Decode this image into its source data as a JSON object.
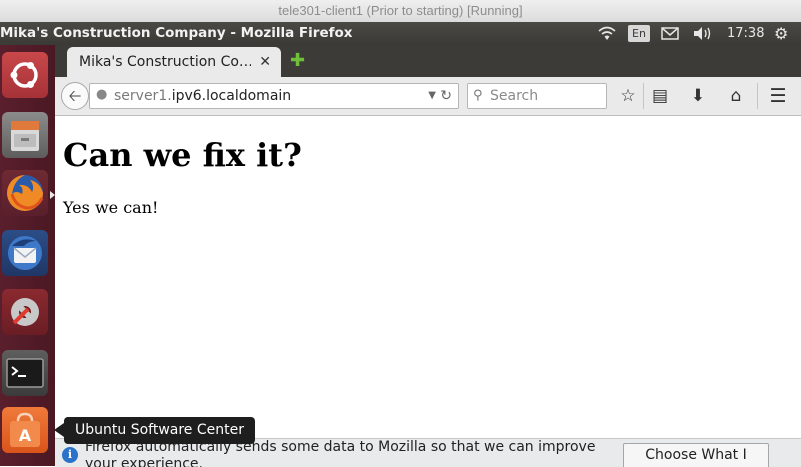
{
  "vm_window": {
    "title": "tele301-client1 (Prior to starting) [Running]"
  },
  "top_panel": {
    "window_title": "Mika's Construction Company - Mozilla Firefox",
    "keyboard_layout": "En",
    "clock": "17:38",
    "icons": [
      "wifi-icon",
      "keyboard-layout-indicator",
      "mail-icon",
      "sound-icon",
      "gear-icon"
    ]
  },
  "launcher": {
    "items": [
      "ubuntu-dash",
      "files",
      "firefox",
      "thunderbird",
      "system-settings",
      "terminal",
      "ubuntu-software-center"
    ],
    "tooltip": "Ubuntu Software Center"
  },
  "browser": {
    "tab_title": "Mika's Construction Co…",
    "url_prefix": "server1.",
    "url_host": "ipv6.localdomain",
    "search_placeholder": "Search"
  },
  "page": {
    "heading": "Can we fix it?",
    "paragraph": "Yes we can!"
  },
  "notification": {
    "text": "Firefox automatically sends some data to Mozilla so that we can improve your experience.",
    "button_label": "Choose What I Share"
  },
  "colors": {
    "launcher_bg": "#5a1f2c",
    "panel_bg": "#3c3b37",
    "firefox_toolbar": "#eaeaea",
    "software_center_orange": "#e8652a"
  }
}
